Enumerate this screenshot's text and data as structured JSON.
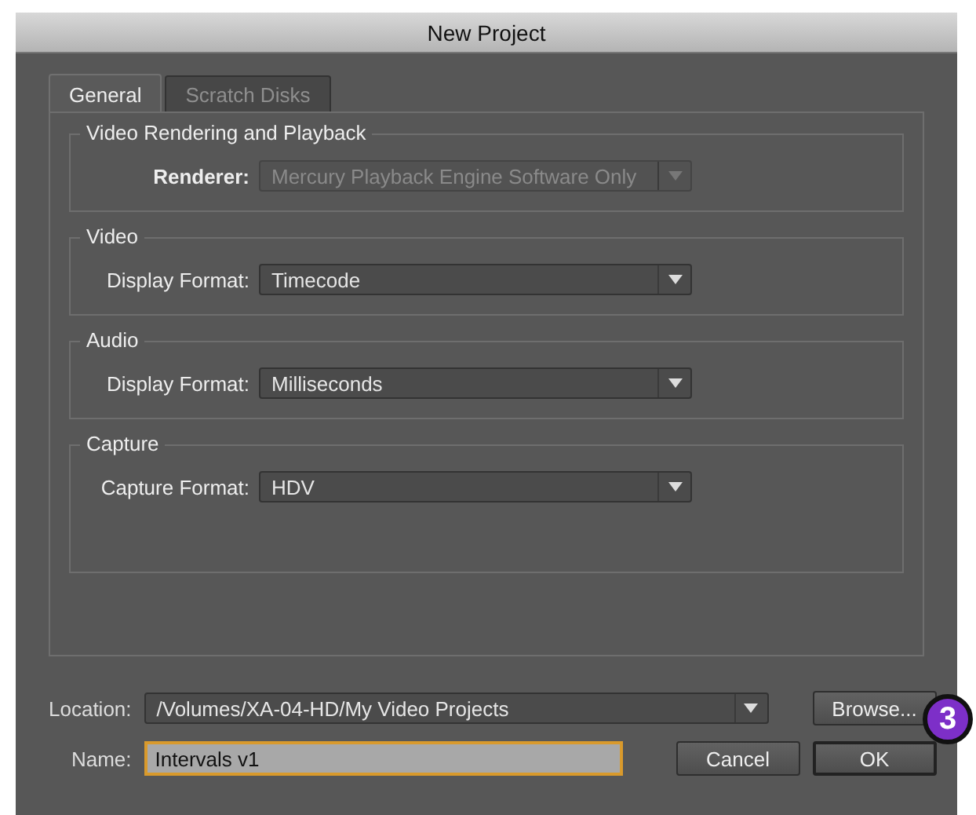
{
  "window": {
    "title": "New Project"
  },
  "tabs": [
    {
      "label": "General",
      "selected": true
    },
    {
      "label": "Scratch Disks",
      "selected": false
    }
  ],
  "groups": [
    {
      "title": "Video Rendering and Playback",
      "field": {
        "label": "Renderer:",
        "value": "Mercury Playback Engine Software Only",
        "disabled": true
      }
    },
    {
      "title": "Video",
      "field": {
        "label": "Display Format:",
        "value": "Timecode",
        "disabled": false
      }
    },
    {
      "title": "Audio",
      "field": {
        "label": "Display Format:",
        "value": "Milliseconds",
        "disabled": false
      }
    },
    {
      "title": "Capture",
      "field": {
        "label": "Capture Format:",
        "value": "HDV",
        "disabled": false
      }
    }
  ],
  "location": {
    "label": "Location:",
    "value": "/Volumes/XA-04-HD/My Video Projects"
  },
  "browse_button": "Browse...",
  "name": {
    "label": "Name:",
    "value": "Intervals v1",
    "focused": true
  },
  "buttons": [
    {
      "label": "Cancel",
      "default": false
    },
    {
      "label": "OK",
      "default": true
    }
  ],
  "step_badge": "3"
}
